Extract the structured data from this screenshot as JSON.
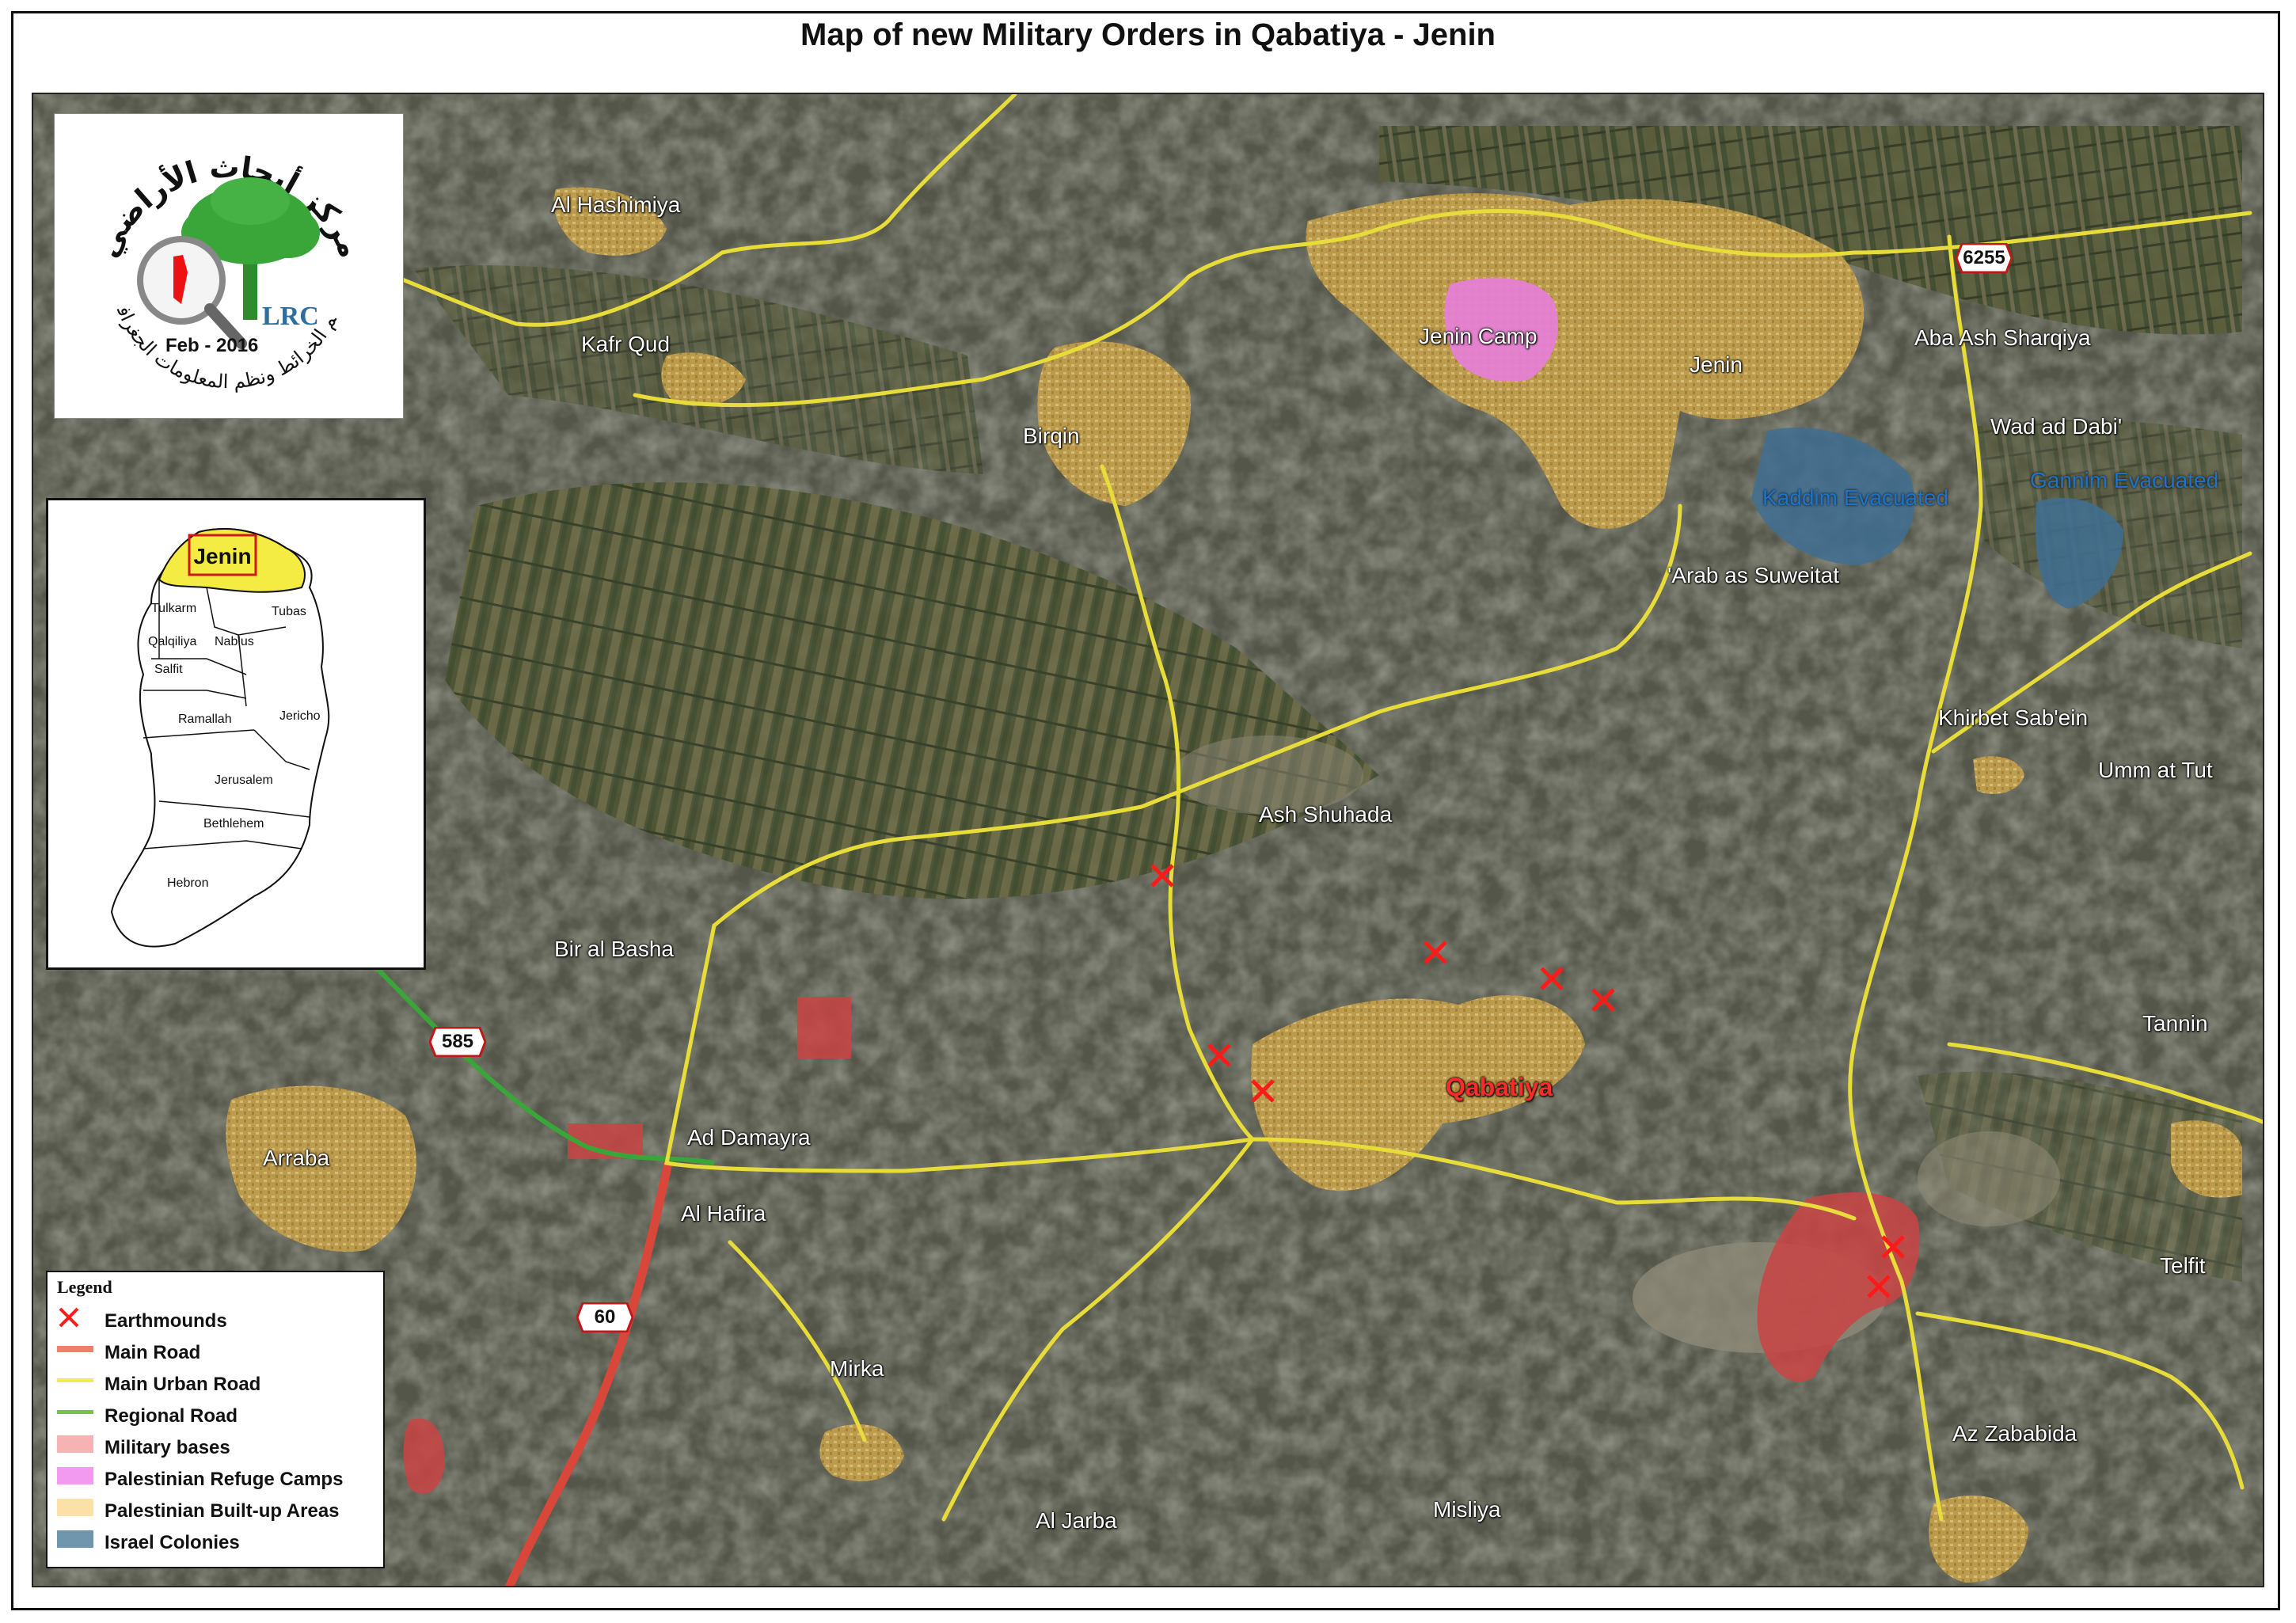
{
  "title": "Map of new Military Orders in Qabatiya - Jenin",
  "logo": {
    "arabic_top": "مركز أبحاث الأراضي",
    "arabic_bottom": "قسم الخرائط ونظم المعلومات الجغرافية",
    "abbr": "LRC",
    "date": "Feb - 2016"
  },
  "inset": {
    "highlight": "Jenin",
    "regions": [
      "Tulkarm",
      "Tubas",
      "Qalqiliya",
      "Nablus",
      "Salfit",
      "Ramallah",
      "Jericho",
      "Jerusalem",
      "Bethlehem",
      "Hebron"
    ]
  },
  "places": {
    "al_hashimiya": "Al Hashimiya",
    "kafr_qud": "Kafr Qud",
    "birqin": "Birqin",
    "jenin_camp": "Jenin Camp",
    "jenin": "Jenin",
    "aba_ash_sharqiya": "Aba Ash Sharqiya",
    "wad_ad_dabi": "Wad ad Dabi'",
    "kaddim": "Kaddim Evacuated",
    "gannim": "Gannim Evacuated",
    "arab_as_suweitat": "'Arab as Suweitat",
    "khirbet_sabein": "Khirbet Sab'ein",
    "umm_at_tut": "Umm at Tut",
    "ash_shuhada": "Ash Shuhada",
    "bir_al_basha": "Bir al Basha",
    "qabatiya": "Qabatiya",
    "tannin": "Tannin",
    "arraba": "Arraba",
    "ad_damayra": "Ad Damayra",
    "al_hafira": "Al Hafira",
    "telfit": "Telfit",
    "mirka": "Mirka",
    "az_zababida": "Az Zababida",
    "al_jarba": "Al Jarba",
    "misliya": "Misliya"
  },
  "road_shields": {
    "r6255": "6255",
    "r585": "585",
    "r60": "60"
  },
  "legend": {
    "title": "Legend",
    "items": [
      {
        "label": "Earthmounds",
        "symbol": "x-mark",
        "color": "#ff1a1a"
      },
      {
        "label": "Main Road",
        "symbol": "line",
        "color": "#f0806a"
      },
      {
        "label": "Main Urban Road",
        "symbol": "line",
        "color": "#f2ea5a"
      },
      {
        "label": "Regional Road",
        "symbol": "line",
        "color": "#7cc242"
      },
      {
        "label": "Military bases",
        "symbol": "fill",
        "color": "#f6b3b3"
      },
      {
        "label": "Palestinian Refuge Camps",
        "symbol": "fill",
        "color": "#f29af0"
      },
      {
        "label": "Palestinian Built-up Areas",
        "symbol": "fill",
        "color": "#fbe1a8"
      },
      {
        "label": "Israel Colonies",
        "symbol": "fill",
        "color": "#6f96ad"
      }
    ]
  },
  "colors": {
    "built_up": "#c9a24a",
    "urban_road": "#e8dc3a",
    "main_road": "#d9473a",
    "regional_road": "#3aa63a",
    "military": "#c94444",
    "camp": "#e67fd8",
    "colony": "#3f6f93",
    "earthmound": "#ff1a1a"
  }
}
